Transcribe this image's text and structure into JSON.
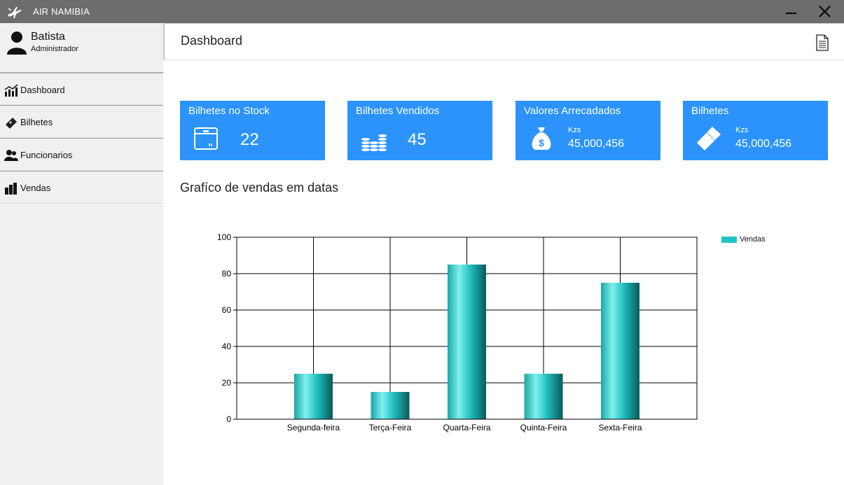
{
  "window": {
    "title": "AIR NAMIBIA"
  },
  "user": {
    "name": "Batista",
    "role": "Administrador"
  },
  "sidebar": {
    "items": [
      {
        "label": "Dashboard",
        "icon": "chart-icon"
      },
      {
        "label": "Bilhetes",
        "icon": "ticket-icon"
      },
      {
        "label": "Funcionarios",
        "icon": "users-icon"
      },
      {
        "label": "Vendas",
        "icon": "coins-icon"
      }
    ]
  },
  "header": {
    "title": "Dashboard"
  },
  "cards": [
    {
      "title": "Bilhetes no Stock",
      "value": "22",
      "icon": "box-icon"
    },
    {
      "title": "Bilhetes Vendidos",
      "value": "45",
      "icon": "coins-icon"
    },
    {
      "title": "Valores Arrecadados",
      "unit": "Kzs",
      "amount": "45,000,456",
      "icon": "money-bag-icon"
    },
    {
      "title": "Bilhetes",
      "unit": "Kzs",
      "amount": "45,000,456",
      "icon": "ticket-icon"
    }
  ],
  "chart_heading": "Grafíco de vendas em datas",
  "colors": {
    "accent": "#2b93fb",
    "titlebar": "#6d6d6d",
    "bar": "#20c4c4"
  },
  "chart_data": {
    "type": "bar",
    "categories": [
      "Segunda-feira",
      "Terça-Feira",
      "Quarta-Feira",
      "Quinta-Feira",
      "Sexta-Feira"
    ],
    "series": [
      {
        "name": "Vendas",
        "values": [
          25,
          15,
          85,
          25,
          75
        ]
      }
    ],
    "ylim": [
      0,
      100
    ],
    "yticks": [
      0,
      20,
      40,
      60,
      80,
      100
    ],
    "grid": true,
    "legend": "top-right"
  }
}
